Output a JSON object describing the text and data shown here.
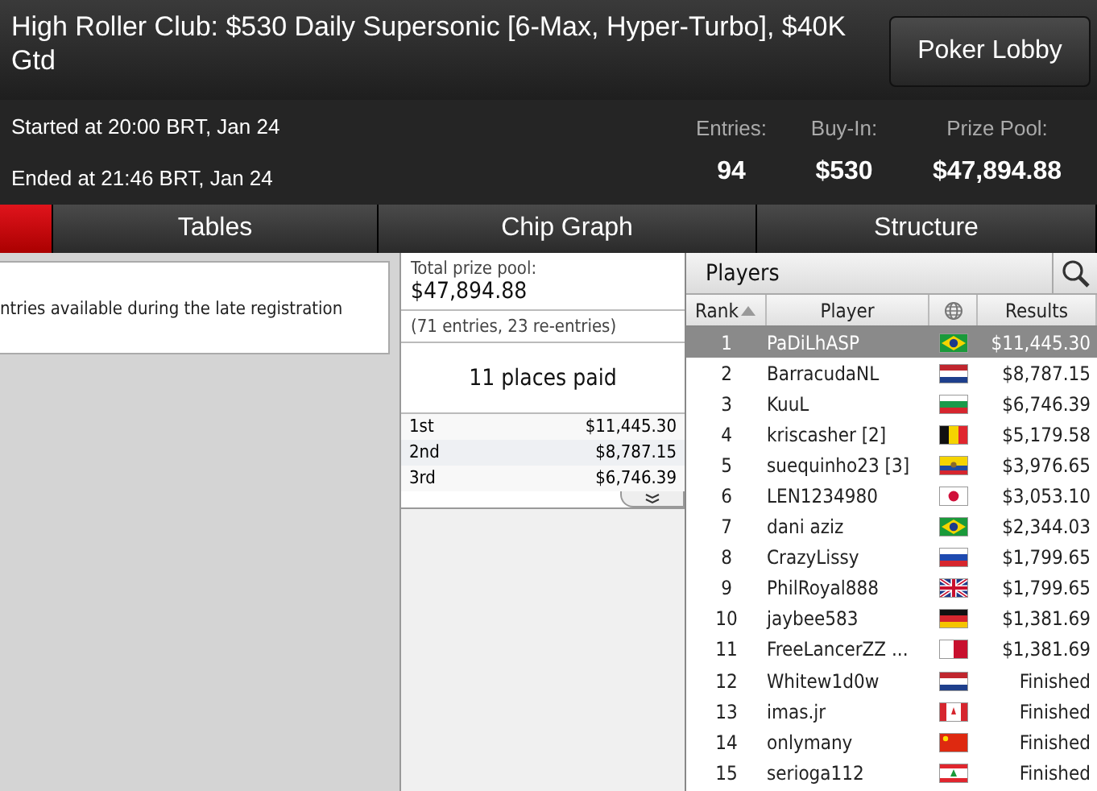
{
  "header": {
    "title": "High Roller Club: $530 Daily Supersonic [6-Max, Hyper-Turbo], $40K Gtd",
    "lobby_button": "Poker Lobby"
  },
  "info": {
    "started": "Started at 20:00 BRT, Jan 24",
    "ended": "Ended at 21:46 BRT, Jan 24",
    "stats": [
      {
        "label": "Entries:",
        "value": "94"
      },
      {
        "label": "Buy-In:",
        "value": "$530"
      },
      {
        "label": "Prize Pool:",
        "value": "$47,894.88"
      }
    ]
  },
  "tabs": [
    {
      "selected": true
    },
    {
      "label": "Tables",
      "selected": false
    },
    {
      "label": "Chip Graph",
      "selected": false
    },
    {
      "label": "Structure",
      "selected": false
    }
  ],
  "notice": "ntries available during the late registration",
  "prizes": {
    "total_label": "Total prize pool:",
    "total": "$47,894.88",
    "entries": "(71 entries, 23 re-entries)",
    "places_paid": "11 places paid",
    "places": [
      {
        "place": "1st",
        "amount": "$11,445.30"
      },
      {
        "place": "2nd",
        "amount": "$8,787.15"
      },
      {
        "place": "3rd",
        "amount": "$6,746.39"
      }
    ]
  },
  "players": {
    "title": "Players",
    "columns": [
      "Rank",
      "Player",
      "Results"
    ],
    "rows": [
      {
        "rank": "1",
        "name": "PaDiLhASP",
        "kind": "br",
        "result": "$11,445.30",
        "selected": true
      },
      {
        "rank": "2",
        "name": "BarracudaNL",
        "kind": "nl",
        "result": "$8,787.15",
        "selected": false
      },
      {
        "rank": "3",
        "name": "KuuL",
        "kind": "bg",
        "result": "$6,746.39",
        "selected": false
      },
      {
        "rank": "4",
        "name": "kriscasher [2]",
        "kind": "be",
        "result": "$5,179.58",
        "selected": false
      },
      {
        "rank": "5",
        "name": "suequinho23 [3]",
        "kind": "ec",
        "result": "$3,976.65",
        "selected": false
      },
      {
        "rank": "6",
        "name": "LEN1234980",
        "kind": "jp",
        "result": "$3,053.10",
        "selected": false
      },
      {
        "rank": "7",
        "name": "dani aziz",
        "kind": "br",
        "result": "$2,344.03",
        "selected": false
      },
      {
        "rank": "8",
        "name": "CrazyLissy",
        "kind": "ru",
        "result": "$1,799.65",
        "selected": false
      },
      {
        "rank": "9",
        "name": "PhilRoyal888",
        "kind": "gb",
        "result": "$1,799.65",
        "selected": false
      },
      {
        "rank": "10",
        "name": "jaybee583",
        "kind": "de",
        "result": "$1,381.69",
        "selected": false
      },
      {
        "rank": "11",
        "name": "FreeLancerZZ ...",
        "kind": "mt",
        "result": "$1,381.69",
        "selected": false
      },
      {
        "rank": "12",
        "name": "Whitew1d0w",
        "kind": "nl",
        "result": "Finished",
        "selected": false
      },
      {
        "rank": "13",
        "name": "imas.jr",
        "kind": "ca",
        "result": "Finished",
        "selected": false
      },
      {
        "rank": "14",
        "name": "onlymany",
        "kind": "cn",
        "result": "Finished",
        "selected": false
      },
      {
        "rank": "15",
        "name": "serioga112",
        "kind": "lb",
        "result": "Finished",
        "selected": false
      }
    ]
  }
}
